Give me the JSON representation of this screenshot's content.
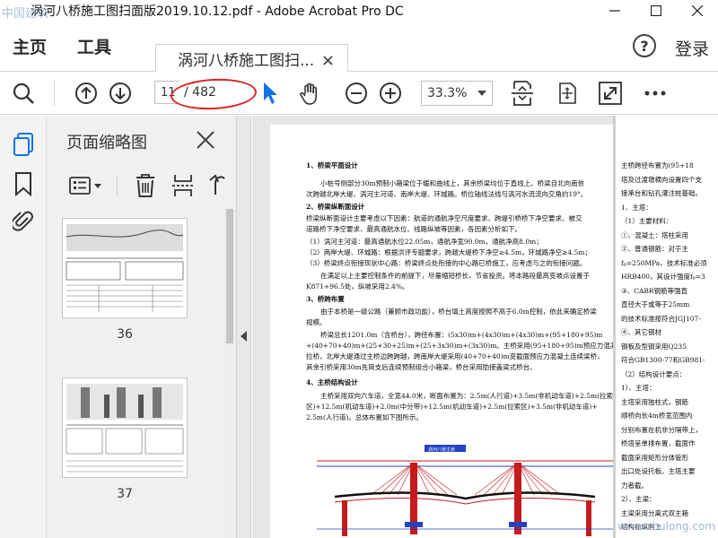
{
  "window": {
    "title": "涡河八桥施工图扫面版2019.10.12.pdf - Adobe Acrobat Pro DC",
    "watermark_top": "中国建筑"
  },
  "menu": {
    "home": "主页",
    "tools": "工具",
    "doc_tab": "涡河八桥施工图扫...",
    "login": "登录",
    "help": "?"
  },
  "toolbar": {
    "current_page": "11",
    "total_pages": "/ 482",
    "zoom": "33.3%",
    "accent_color": "#1473e6",
    "annotation_color": "#d62424"
  },
  "panel": {
    "title": "页面缩略图",
    "thumbnails": [
      {
        "label": "36"
      },
      {
        "label": "37"
      }
    ]
  },
  "document": {
    "left_column": [
      {
        "text": "1、桥梁平面设计",
        "heading": true
      },
      {
        "text": "小桩号侧部分30m预制小箱梁位于缓和曲线上，其余桥梁均位于直线上。桥梁自北向南依",
        "heading": false
      },
      {
        "text": "次跨越北岸大堤、涡河主河道、南岸大堤、环城路。桥位轴线法线与涡河水流流向交角约19°。",
        "heading": false
      },
      {
        "text": "2、桥梁纵断面设计",
        "heading": true
      },
      {
        "text": "桥梁纵断面设计主要考虑以下因素：航道的通航净空尺度要求、跨堤引桥桥下净空要求、被交",
        "heading": false
      },
      {
        "text": "道路桥下净空要求、最高通航水位、线路纵坡等因素，各因素分析如下。",
        "heading": false
      },
      {
        "text": "（1）涡河主河道：最高通航水位22.05m，通航净宽90.0m，通航净高8.0m；",
        "heading": false
      },
      {
        "text": "（2）两岸大堤、环城路：根据洪评专题要求，跨越大堤桥下净空≥4.5m，环城路净空≥4.5m；",
        "heading": false
      },
      {
        "text": "（3）桥梁终点衔接现状中心路：桥梁终点处衔接的中心路已桥施工，应考虑与之的衔接问题。",
        "heading": false
      },
      {
        "text": "在满足以上主要控制条件的前提下，尽量缩短桥长，节省投资。将本路段最高变坡点设置于",
        "heading": false
      },
      {
        "text": "K871+96.5处，纵坡采用2.4%。",
        "heading": false
      },
      {
        "text": "3、桥跨布置",
        "heading": true
      },
      {
        "text": "由于本桥是一级公路（兼顾市政功能），桥台填土高度按照不高于6.0m控制，依此来确定桥梁",
        "heading": false
      },
      {
        "text": "规模。",
        "heading": false
      },
      {
        "text": "桥梁总长1201.0m（含桥台），跨径布置：(5x30)m+(4x30)m+(4x30)m+(95+180+95)m",
        "heading": false
      },
      {
        "text": "+(40+70+40)m+(25+30+25)m+(25+3x30)m+(3x30)m。主桥采用(95+180+95)m预应力混凝土矮塔斜",
        "heading": false
      },
      {
        "text": "拉桥，北岸大堤通过主桥边跨跨越，跨南岸大堤采用(40+70+40)m变截面预应力混凝土连续梁桥，",
        "heading": false
      },
      {
        "text": "其余引桥采用30m先简支后连续预制组合小箱梁，桥台采用肋接盖梁式桥台。",
        "heading": false
      },
      {
        "text": "4、主桥结构设计",
        "heading": true
      },
      {
        "text": "主桥采用双向六车道，全宽44.0米，断面布置为：2.5m(人行道)+3.5m(非机动车道)+2.5m(拉索",
        "heading": false
      },
      {
        "text": "区)+12.5m(机动车道)+2.0m(中分带)+12.5m(机动车道)+2.5m(拉索区)+3.5m(非机动车道)+",
        "heading": false
      },
      {
        "text": "2.5m(人行道)。总体布置如下图所示。",
        "heading": false
      }
    ],
    "right_column": [
      "主桥跨径布置为(95+18",
      "塔及过渡墩横向设置四个支",
      "接承台和钻孔灌注桩基础。",
      "1、主塔：",
      "（1）主要材料：",
      "①、混凝土：塔柱采用",
      "②、普通钢筋：对于主",
      "fₚ=250MPa，技术标准必须",
      "HRB400，其设计强度fₚ=3",
      "③、CABR钢筋等强直",
      "直径大于或等于25mm",
      "的技术标准按符合JGJ107-",
      "④、其它钢材",
      "钢板及型钢采用Q235",
      "符合GB1300-77和GB981-",
      "（2）结构设计要点：",
      "1）、主塔：",
      "主塔采用独柱式，钢筋",
      "顺桥向长4m桥宽范围内",
      "分别布置在机非分隔带上，",
      "桥塔呈单排布置，截面作",
      "截面采用矩形分体管形",
      "出口处设托板。主塔主要",
      "力者截。",
      "2）、主梁：",
      "主梁采用分离式双主箱",
      "结构在纵向上"
    ],
    "diagram_label": "涡河八桥主桥",
    "bottom_watermark": "www.zhulong.com"
  }
}
